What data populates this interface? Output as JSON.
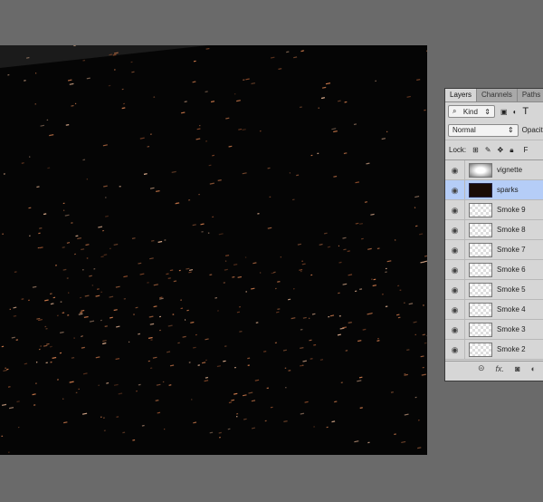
{
  "panel": {
    "tabs": [
      "Layers",
      "Channels",
      "Paths"
    ],
    "filter_kind": "Kind",
    "blend_mode": "Normal",
    "opacity_label": "Opacity:",
    "lock_label": "Lock:",
    "fill_label": "F",
    "layers": [
      {
        "name": "vignette",
        "selected": false
      },
      {
        "name": "sparks",
        "selected": true
      },
      {
        "name": "Smoke 9"
      },
      {
        "name": "Smoke 8"
      },
      {
        "name": "Smoke 7"
      },
      {
        "name": "Smoke 6"
      },
      {
        "name": "Smoke 5"
      },
      {
        "name": "Smoke 4"
      },
      {
        "name": "Smoke 3"
      },
      {
        "name": "Smoke 2"
      }
    ],
    "selected_color": "#b5cdf7"
  }
}
